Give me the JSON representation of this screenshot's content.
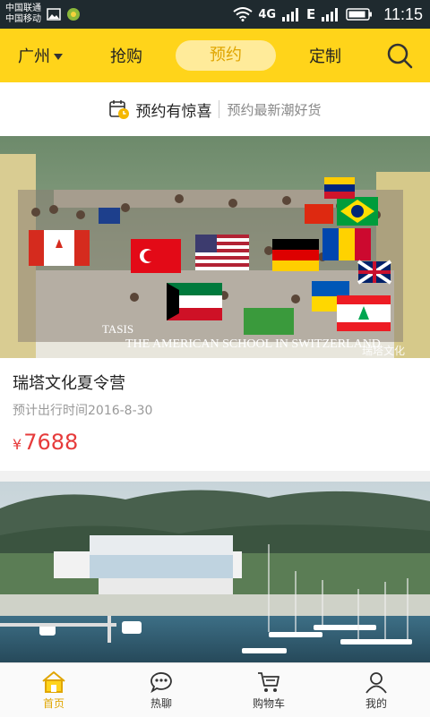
{
  "status_bar": {
    "carrier1": "中国联通",
    "carrier2": "中国移动",
    "network1": "4G",
    "network2": "E",
    "time": "11:15"
  },
  "nav": {
    "city": "广州",
    "tabs": [
      "抢购",
      "预约",
      "定制"
    ],
    "active_tab": "预约",
    "accent": "#ffd41a"
  },
  "banner": {
    "title": "预约有惊喜",
    "subtitle": "预约最新潮好货"
  },
  "products": [
    {
      "title": "瑞塔文化夏令营",
      "date": "预计出行时间2016-8-30",
      "currency": "¥",
      "price": "7688",
      "image_caption": "THE AMERICAN SCHOOL IN SWITZERLAND",
      "image_watermark_left": "TASIS",
      "image_watermark_right": "瑞塔文化"
    },
    {
      "title": "",
      "date": "",
      "price": ""
    }
  ],
  "bottom_nav": [
    {
      "label": "首页",
      "icon": "home-icon",
      "active": true
    },
    {
      "label": "热聊",
      "icon": "chat-icon",
      "active": false
    },
    {
      "label": "购物车",
      "icon": "cart-icon",
      "active": false
    },
    {
      "label": "我的",
      "icon": "user-icon",
      "active": false
    }
  ]
}
